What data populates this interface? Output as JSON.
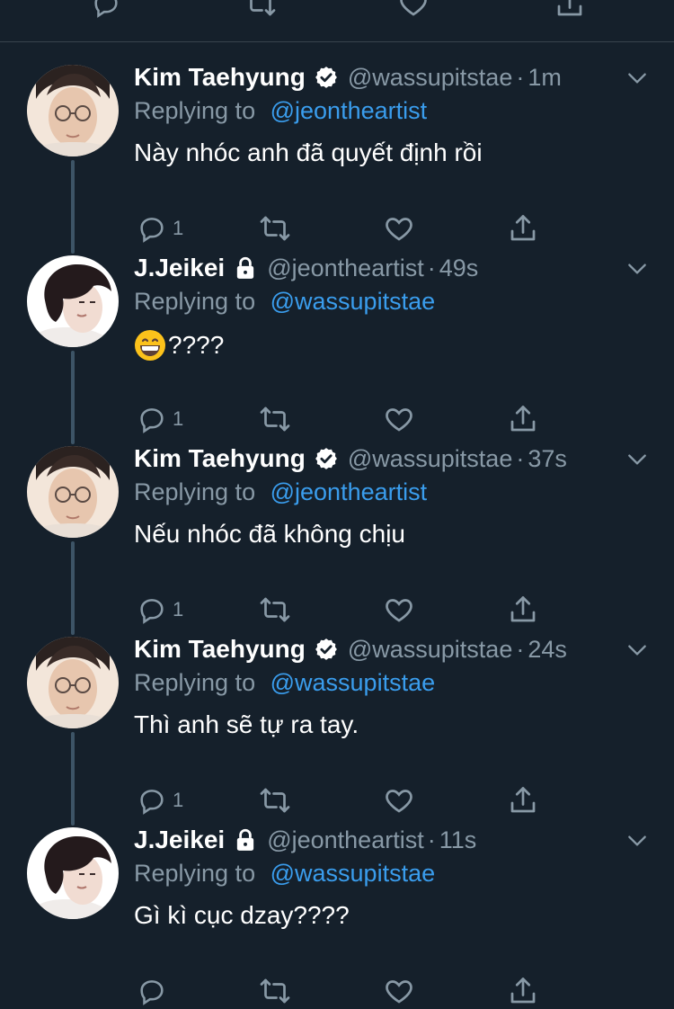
{
  "reply_prefix": "Replying to",
  "tweets": [
    {
      "name": "Kim Taehyung",
      "badge": "verified-icon",
      "handle": "@wassupitstae",
      "dot": "·",
      "time": "1m",
      "replying_to": "@jeontheartist",
      "text": "Này nhóc anh đã quyết định rồi",
      "reply_count": "1",
      "avatar": "avatar-taehyung"
    },
    {
      "name": "J.Jeikei",
      "badge": "lock-icon",
      "handle": "@jeontheartist",
      "dot": "·",
      "time": "49s",
      "replying_to": "@wassupitstae",
      "emoji": "grinning-face-emoji",
      "text": "????",
      "reply_count": "1",
      "avatar": "avatar-jeikei"
    },
    {
      "name": "Kim Taehyung",
      "badge": "verified-icon",
      "handle": "@wassupitstae",
      "dot": "·",
      "time": "37s",
      "replying_to": "@jeontheartist",
      "text": "Nếu nhóc đã không chịu",
      "reply_count": "1",
      "avatar": "avatar-taehyung"
    },
    {
      "name": "Kim Taehyung",
      "badge": "verified-icon",
      "handle": "@wassupitstae",
      "dot": "·",
      "time": "24s",
      "replying_to": "@wassupitstae",
      "text": "Thì anh sẽ tự ra tay.",
      "reply_count": "1",
      "avatar": "avatar-taehyung"
    },
    {
      "name": "J.Jeikei",
      "badge": "lock-icon",
      "handle": "@jeontheartist",
      "dot": "·",
      "time": "11s",
      "replying_to": "@wassupitstae",
      "text": "Gì kì cục dzay????",
      "reply_count": "",
      "avatar": "avatar-jeikei"
    }
  ],
  "colors": {
    "background": "#15202b",
    "secondary_text": "#8899a6",
    "link": "#3a9ded",
    "divider": "#38444d",
    "thread_line": "#3d5466"
  }
}
